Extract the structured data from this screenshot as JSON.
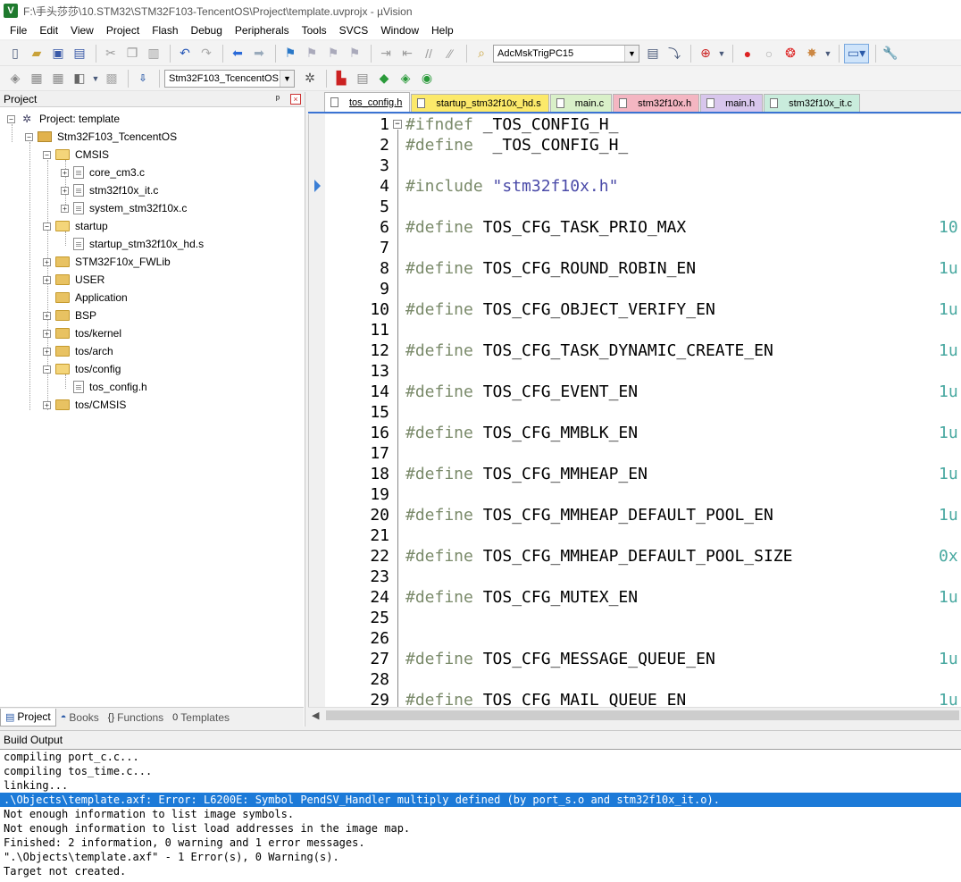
{
  "window": {
    "title": "F:\\手头莎莎\\10.STM32\\STM32F103-TencentOS\\Project\\template.uvprojx - µVision",
    "app_icon_letter": "V"
  },
  "menu": [
    "File",
    "Edit",
    "View",
    "Project",
    "Flash",
    "Debug",
    "Peripherals",
    "Tools",
    "SVCS",
    "Window",
    "Help"
  ],
  "toolbar": {
    "find_combo_value": "AdcMskTrigPC15",
    "target_combo_value": "Stm32F103_TcencentOS",
    "icons_row1": [
      "new-file-icon",
      "open-icon",
      "save-icon",
      "save-all-icon",
      "cut-icon",
      "copy-icon",
      "paste-icon",
      "undo-icon",
      "redo-icon",
      "back-icon",
      "forward-icon",
      "bookmark-icon",
      "prev-bookmark-icon",
      "next-bookmark-icon",
      "clear-bookmarks-icon",
      "find-in-files-icon",
      "search-icon",
      "debug-icon",
      "breakpoint-icon",
      "disable-breakpoint-icon",
      "kill-breakpoints-icon",
      "window-layout-icon",
      "settings-icon"
    ],
    "icons_row2": [
      "translate-icon",
      "build-icon",
      "rebuild-icon",
      "batch-build-icon",
      "stop-build-icon",
      "load-icon",
      "options-icon",
      "manage-icon"
    ]
  },
  "project_panel": {
    "title": "Project",
    "pin_label": "ᵖ",
    "close_label": "×",
    "tree": [
      {
        "label": "Project: template",
        "depth": 0,
        "kind": "project",
        "toggle": "-"
      },
      {
        "label": "Stm32F103_TcencentOS",
        "depth": 1,
        "kind": "target",
        "toggle": "-"
      },
      {
        "label": "CMSIS",
        "depth": 2,
        "kind": "folder-open",
        "toggle": "-"
      },
      {
        "label": "core_cm3.c",
        "depth": 3,
        "kind": "file",
        "toggle": "+"
      },
      {
        "label": "stm32f10x_it.c",
        "depth": 3,
        "kind": "file",
        "toggle": "+"
      },
      {
        "label": "system_stm32f10x.c",
        "depth": 3,
        "kind": "file",
        "toggle": "+"
      },
      {
        "label": "startup",
        "depth": 2,
        "kind": "folder-open",
        "toggle": "-"
      },
      {
        "label": "startup_stm32f10x_hd.s",
        "depth": 3,
        "kind": "file",
        "toggle": ""
      },
      {
        "label": "STM32F10x_FWLib",
        "depth": 2,
        "kind": "folder",
        "toggle": "+"
      },
      {
        "label": "USER",
        "depth": 2,
        "kind": "folder",
        "toggle": "+"
      },
      {
        "label": "Application",
        "depth": 2,
        "kind": "folder",
        "toggle": ""
      },
      {
        "label": "BSP",
        "depth": 2,
        "kind": "folder",
        "toggle": "+"
      },
      {
        "label": "tos/kernel",
        "depth": 2,
        "kind": "folder",
        "toggle": "+"
      },
      {
        "label": "tos/arch",
        "depth": 2,
        "kind": "folder",
        "toggle": "+"
      },
      {
        "label": "tos/config",
        "depth": 2,
        "kind": "folder-open",
        "toggle": "-"
      },
      {
        "label": "tos_config.h",
        "depth": 3,
        "kind": "file",
        "toggle": ""
      },
      {
        "label": "tos/CMSIS",
        "depth": 2,
        "kind": "folder",
        "toggle": "+"
      }
    ],
    "tabs": [
      {
        "label": "Project",
        "icon": "project-tab-icon",
        "active": true
      },
      {
        "label": "Books",
        "icon": "books-tab-icon",
        "active": false
      },
      {
        "label": "Functions",
        "icon": "functions-tab-icon",
        "active": false
      },
      {
        "label": "Templates",
        "icon": "templates-tab-icon",
        "active": false
      }
    ]
  },
  "editor": {
    "tabs": [
      {
        "label": "tos_config.h",
        "color": "white",
        "active": true
      },
      {
        "label": "startup_stm32f10x_hd.s",
        "color": "yellow",
        "active": false
      },
      {
        "label": "main.c",
        "color": "green",
        "active": false
      },
      {
        "label": "stm32f10x.h",
        "color": "pink",
        "active": false
      },
      {
        "label": "main.h",
        "color": "lilac",
        "active": false
      },
      {
        "label": "stm32f10x_it.c",
        "color": "mint",
        "active": false
      }
    ],
    "current_line": 4,
    "lines": [
      {
        "n": "1",
        "kw": "#ifndef",
        "text": " _TOS_CONFIG_H_",
        "val": ""
      },
      {
        "n": "2",
        "kw": "#define",
        "text": "  _TOS_CONFIG_H_",
        "val": ""
      },
      {
        "n": "3",
        "kw": "",
        "text": "",
        "val": ""
      },
      {
        "n": "4",
        "kw": "#include",
        "text": "",
        "str": " \"stm32f10x.h\"",
        "val": ""
      },
      {
        "n": "5",
        "kw": "",
        "text": "",
        "val": ""
      },
      {
        "n": "6",
        "kw": "#define",
        "text": " TOS_CFG_TASK_PRIO_MAX",
        "val": "10"
      },
      {
        "n": "7",
        "kw": "",
        "text": "",
        "val": ""
      },
      {
        "n": "8",
        "kw": "#define",
        "text": " TOS_CFG_ROUND_ROBIN_EN",
        "val": "1u"
      },
      {
        "n": "9",
        "kw": "",
        "text": "",
        "val": ""
      },
      {
        "n": "10",
        "kw": "#define",
        "text": " TOS_CFG_OBJECT_VERIFY_EN",
        "val": "1u"
      },
      {
        "n": "11",
        "kw": "",
        "text": "",
        "val": ""
      },
      {
        "n": "12",
        "kw": "#define",
        "text": " TOS_CFG_TASK_DYNAMIC_CREATE_EN",
        "val": "1u"
      },
      {
        "n": "13",
        "kw": "",
        "text": "",
        "val": ""
      },
      {
        "n": "14",
        "kw": "#define",
        "text": " TOS_CFG_EVENT_EN",
        "val": "1u"
      },
      {
        "n": "15",
        "kw": "",
        "text": "",
        "val": ""
      },
      {
        "n": "16",
        "kw": "#define",
        "text": " TOS_CFG_MMBLK_EN",
        "val": "1u"
      },
      {
        "n": "17",
        "kw": "",
        "text": "",
        "val": ""
      },
      {
        "n": "18",
        "kw": "#define",
        "text": " TOS_CFG_MMHEAP_EN",
        "val": "1u"
      },
      {
        "n": "19",
        "kw": "",
        "text": "",
        "val": ""
      },
      {
        "n": "20",
        "kw": "#define",
        "text": " TOS_CFG_MMHEAP_DEFAULT_POOL_EN",
        "val": "1u"
      },
      {
        "n": "21",
        "kw": "",
        "text": "",
        "val": ""
      },
      {
        "n": "22",
        "kw": "#define",
        "text": " TOS_CFG_MMHEAP_DEFAULT_POOL_SIZE",
        "val": "0x"
      },
      {
        "n": "23",
        "kw": "",
        "text": "",
        "val": ""
      },
      {
        "n": "24",
        "kw": "#define",
        "text": " TOS_CFG_MUTEX_EN",
        "val": "1u"
      },
      {
        "n": "25",
        "kw": "",
        "text": "",
        "val": ""
      },
      {
        "n": "26",
        "kw": "",
        "text": "",
        "val": ""
      },
      {
        "n": "27",
        "kw": "#define",
        "text": " TOS_CFG_MESSAGE_QUEUE_EN",
        "val": "1u"
      },
      {
        "n": "28",
        "kw": "",
        "text": "",
        "val": ""
      },
      {
        "n": "29",
        "kw": "#define",
        "text": " TOS_CFG_MAIL_QUEUE_EN",
        "val": "1u"
      }
    ]
  },
  "build_output": {
    "title": "Build Output",
    "selected_index": 3,
    "lines": [
      "compiling port_c.c...",
      "compiling tos_time.c...",
      "linking...",
      ".\\Objects\\template.axf: Error: L6200E: Symbol PendSV_Handler multiply defined (by port_s.o and stm32f10x_it.o).",
      "Not enough information to list image symbols.",
      "Not enough information to list load addresses in the image map.",
      "Finished: 2 information, 0 warning and 1 error messages.",
      "\".\\Objects\\template.axf\" - 1 Error(s), 0 Warning(s).",
      "Target not created."
    ]
  }
}
